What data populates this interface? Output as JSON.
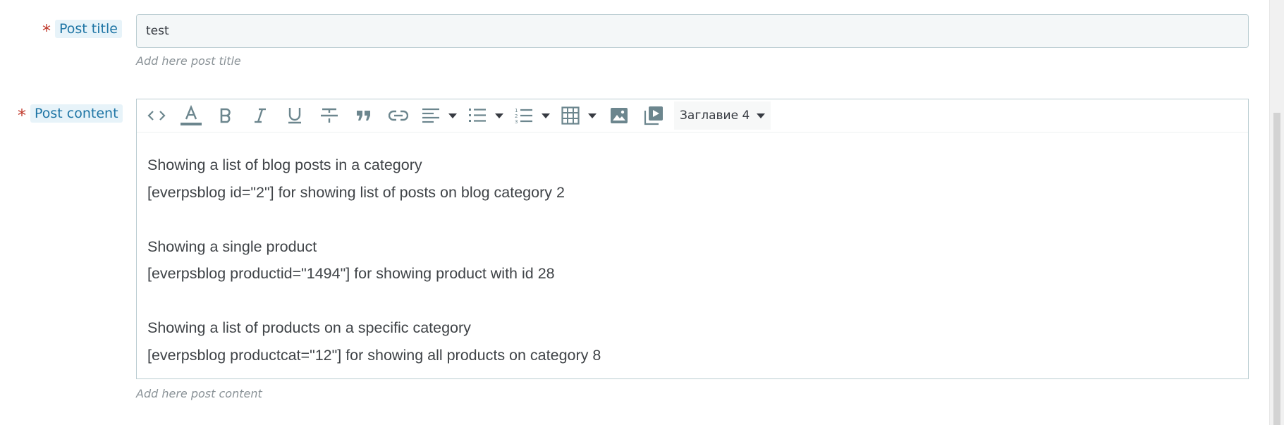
{
  "post_title_field": {
    "required_marker": "*",
    "label": "Post title",
    "value": "test",
    "help": "Add here post title"
  },
  "post_content_field": {
    "required_marker": "*",
    "label": "Post content",
    "help": "Add here post content",
    "toolbar": {
      "icons": [
        "source-code-icon",
        "text-color-icon",
        "bold-icon",
        "italic-icon",
        "underline-icon",
        "strikethrough-icon",
        "blockquote-icon",
        "link-icon",
        "align-left-icon",
        "bullet-list-icon",
        "numbered-list-icon",
        "table-icon",
        "image-icon",
        "media-icon"
      ],
      "format_select": "Заглавие 4",
      "text_color_bar": "#6c868e"
    },
    "content": {
      "p1": "Showing a list of blog posts in a category",
      "p2": "[everpsblog id=\"2\"] for showing list of posts on blog category 2",
      "p3": "Showing a single product",
      "p4": "[everpsblog productid=\"1494\"] for showing product with id 28",
      "p5": "Showing a list of products on a specific category",
      "p6": "[everpsblog productcat=\"12\"] for showing all products on category 8"
    }
  },
  "colors": {
    "label_text": "#1e75a5",
    "label_bg": "#e7f3f9",
    "required": "#c0392b",
    "border": "#bbcdd2",
    "icon": "#6c868e"
  }
}
